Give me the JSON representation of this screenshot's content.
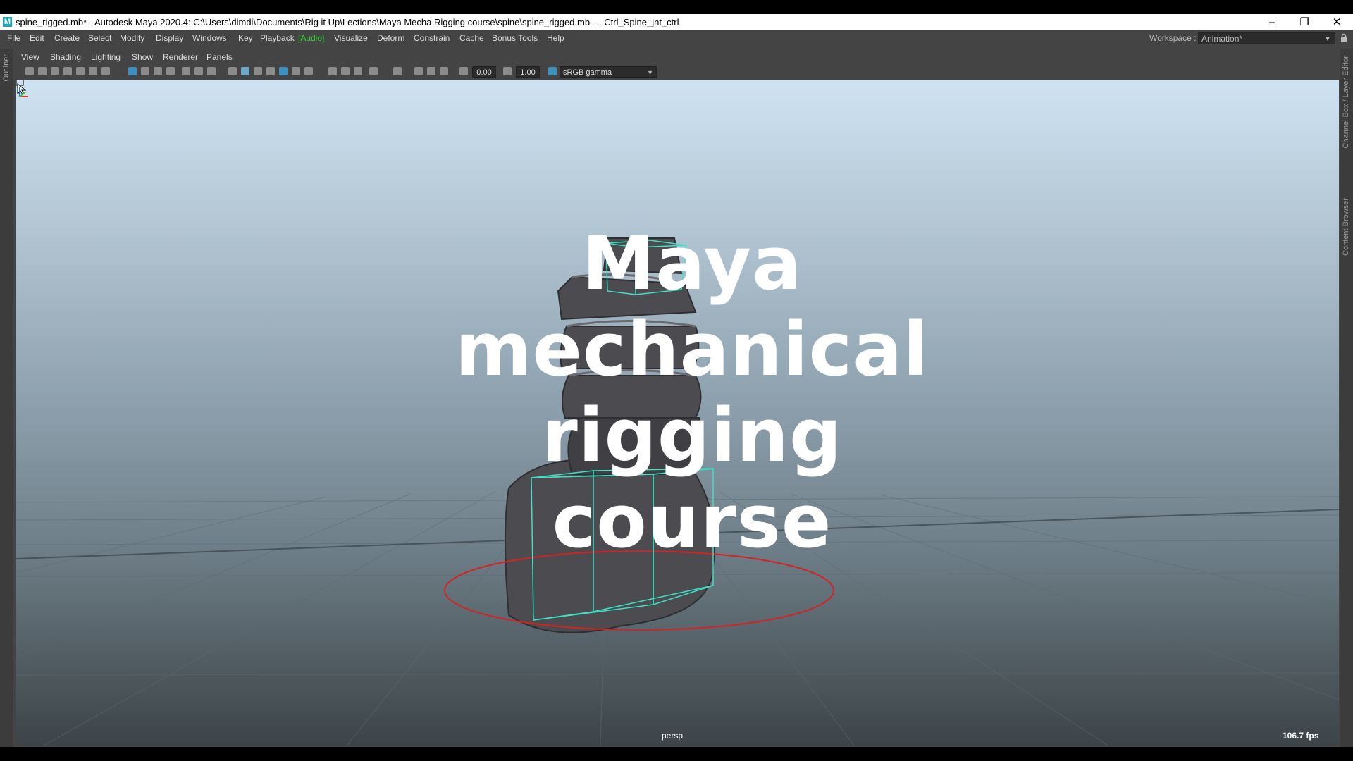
{
  "window": {
    "logo": "M",
    "title": "spine_rigged.mb* - Autodesk Maya 2020.4: C:\\Users\\dimdi\\Documents\\Rig it Up\\Lections\\Maya Mecha Rigging course\\spine\\spine_rigged.mb   ---   Ctrl_Spine_jnt_ctrl",
    "minimize": "–",
    "restore": "❐",
    "close": "✕"
  },
  "menubar": {
    "items": [
      "File",
      "Edit",
      "Create",
      "Select",
      "Modify",
      "Display",
      "Windows",
      "Key",
      "Playback",
      "[Audio]",
      "Visualize",
      "Deform",
      "Constrain",
      "Cache",
      "Bonus Tools",
      "Help"
    ],
    "workspace_label": "Workspace :",
    "workspace_value": "Animation*"
  },
  "side_tabs": {
    "left": "Outliner",
    "right_top": "Channel Box / Layer Editor",
    "right_bottom": "Content Browser"
  },
  "panel_menu": [
    "View",
    "Shading",
    "Lighting",
    "Show",
    "Renderer",
    "Panels"
  ],
  "toolbar": {
    "exposure": "0.00",
    "gamma": "1.00",
    "color_space": "sRGB gamma"
  },
  "viewport": {
    "overlay_lines": [
      "Maya",
      "mechanical",
      "rigging",
      "course"
    ],
    "camera": "persp",
    "fps": "106.7 fps",
    "colors": {
      "root_control": "#d22424",
      "joint_controls": "#3fe0c4",
      "mesh": "#4b4b50"
    }
  }
}
